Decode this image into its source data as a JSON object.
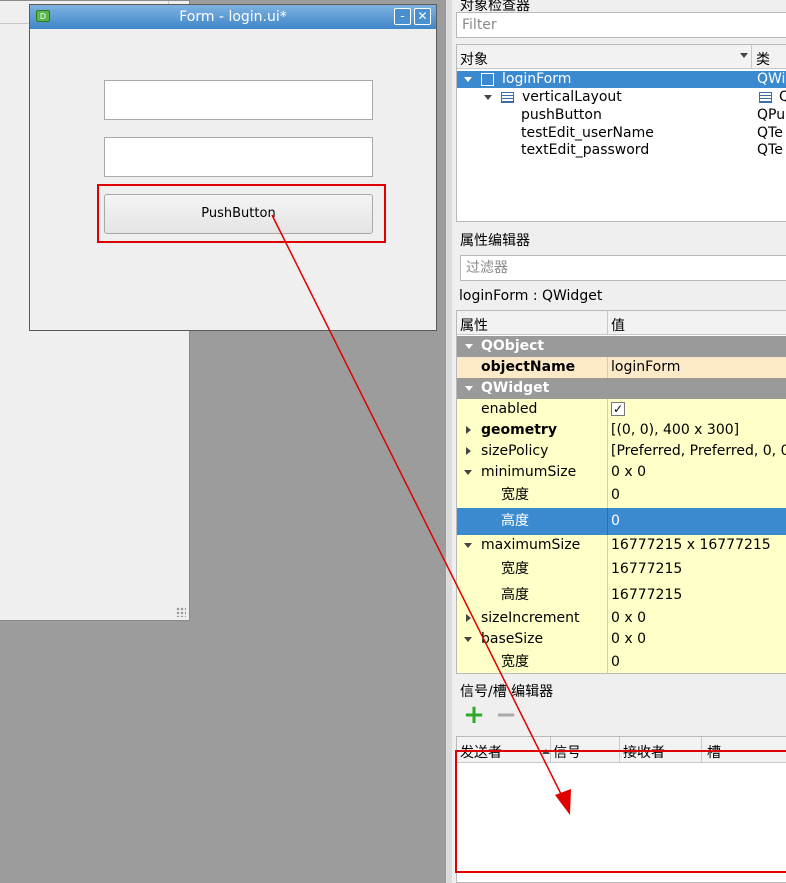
{
  "colors": {
    "selection": "#3b8ad0",
    "annotation_red": "#e00000",
    "property_row": "#ffffc8",
    "group_row": "#9a9a9a"
  },
  "form_window": {
    "title": "Form - login.ui*",
    "icon_glyph": "D",
    "minimize_label": "-",
    "close_label": "✕",
    "username_value": "",
    "password_value": "",
    "push_button_label": "PushButton"
  },
  "object_inspector": {
    "title": "对象检查器",
    "filter_placeholder": "Filter",
    "header_object": "对象",
    "header_class": "类",
    "rows": [
      {
        "name": "loginForm",
        "class": "QWi"
      },
      {
        "name": "verticalLayout",
        "class": "Q"
      },
      {
        "name": "pushButton",
        "class": "QPu"
      },
      {
        "name": "testEdit_userName",
        "class": "QTe"
      },
      {
        "name": "textEdit_password",
        "class": "QTe"
      }
    ]
  },
  "property_editor": {
    "title": "属性编辑器",
    "filter_placeholder": "过滤器",
    "context": "loginForm : QWidget",
    "header_property": "属性",
    "header_value": "值",
    "rows": [
      {
        "name": "QObject",
        "value": ""
      },
      {
        "name": "objectName",
        "value": "loginForm"
      },
      {
        "name": "QWidget",
        "value": ""
      },
      {
        "name": "enabled",
        "value": "✓"
      },
      {
        "name": "geometry",
        "value": "[(0, 0), 400 x 300]"
      },
      {
        "name": "sizePolicy",
        "value": "[Preferred, Preferred, 0, 0"
      },
      {
        "name": "minimumSize",
        "value": "0 x 0"
      },
      {
        "name": "宽度",
        "value": "0"
      },
      {
        "name": "高度",
        "value": "0"
      },
      {
        "name": "maximumSize",
        "value": "16777215 x 16777215"
      },
      {
        "name": "宽度",
        "value": "16777215"
      },
      {
        "name": "高度",
        "value": "16777215"
      },
      {
        "name": "sizeIncrement",
        "value": "0 x 0"
      },
      {
        "name": "baseSize",
        "value": "0 x 0"
      },
      {
        "name": "宽度",
        "value": "0"
      }
    ]
  },
  "signal_slot_editor": {
    "title": "信号/槽 编辑器",
    "add_label": "+",
    "remove_label": "−",
    "columns": [
      "发送者",
      "信号",
      "接收者",
      "槽"
    ]
  }
}
